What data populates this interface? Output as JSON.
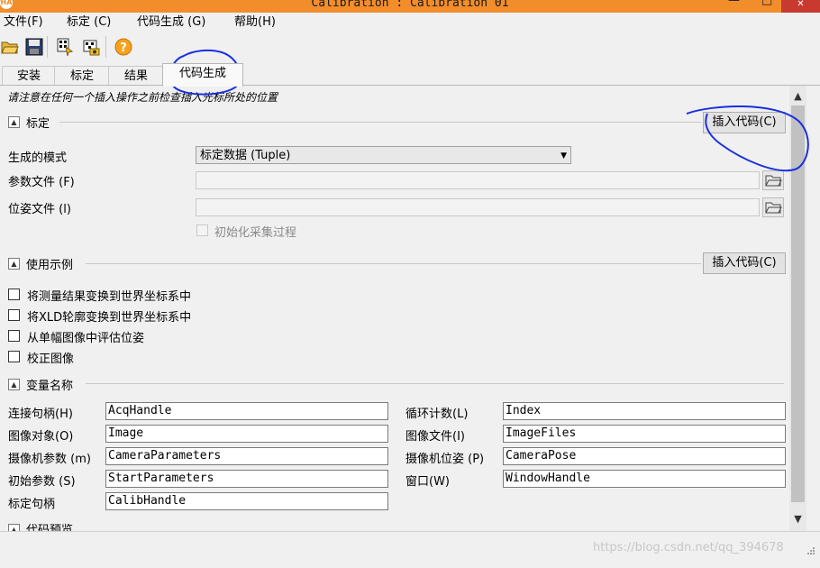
{
  "window": {
    "title": "Calibration : Calibration 01",
    "app_icon_text": "HA",
    "minimize": "—",
    "maximize": "□",
    "close": "✕"
  },
  "menu": [
    {
      "label": "文件(F)"
    },
    {
      "label": "标定 (C)"
    },
    {
      "label": "代码生成 (G)"
    },
    {
      "label": "帮助(H)"
    }
  ],
  "toolbar": {
    "icons": [
      "open-folder-icon",
      "save-icon",
      "calibrate-icon",
      "camera-icon",
      "help-icon"
    ]
  },
  "tabs": [
    {
      "label": "安装"
    },
    {
      "label": "标定"
    },
    {
      "label": "结果"
    },
    {
      "label": "代码生成",
      "active": true
    }
  ],
  "notice": "请注意在任何一个插入操作之前检查插入光标所处的位置",
  "calibration_group": {
    "title": "标定",
    "insert_button": "插入代码(C)",
    "mode_label": "生成的模式",
    "mode_value": "标定数据 (Tuple)",
    "param_file_label": "参数文件 (F)",
    "param_file_value": "",
    "pose_file_label": "位姿文件 (l)",
    "pose_file_value": "",
    "init_acq_label": "初始化采集过程"
  },
  "usage_group": {
    "title": "使用示例",
    "insert_button": "插入代码(C)",
    "options": [
      {
        "label": "将测量结果变换到世界坐标系中",
        "checked": false
      },
      {
        "label": "将XLD轮廓变换到世界坐标系中",
        "checked": false
      },
      {
        "label": "从单幅图像中评估位姿",
        "checked": false
      },
      {
        "label": "校正图像",
        "checked": false
      }
    ]
  },
  "variables_group": {
    "title": "变量名称",
    "left": [
      {
        "label": "连接句柄(H)",
        "value": "AcqHandle"
      },
      {
        "label": "图像对象(O)",
        "value": "Image"
      },
      {
        "label": "摄像机参数 (m)",
        "value": "CameraParameters"
      },
      {
        "label": "初始参数 (S)",
        "value": "StartParameters"
      },
      {
        "label": "标定句柄",
        "value": "CalibHandle"
      }
    ],
    "right": [
      {
        "label": "循环计数(L)",
        "value": "Index"
      },
      {
        "label": "图像文件(I)",
        "value": "ImageFiles"
      },
      {
        "label": "摄像机位姿 (P)",
        "value": "CameraPose"
      },
      {
        "label": "窗口(W)",
        "value": "WindowHandle"
      }
    ]
  },
  "code_preview_group": {
    "title": "代码预览"
  },
  "scrollbar": {
    "up": "▲",
    "down": "▼"
  },
  "watermark": "https://blog.csdn.net/qq_394678",
  "colors": {
    "titlebar": "#f28d2c",
    "close": "#c8392f",
    "annotation": "#1a2fe0"
  }
}
